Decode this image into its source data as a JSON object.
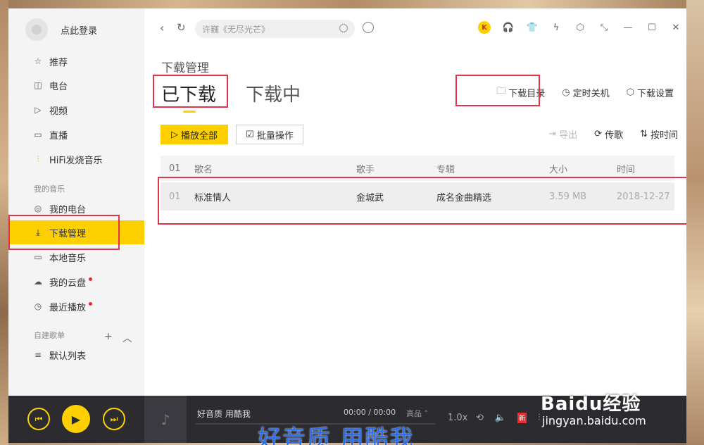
{
  "sidebar": {
    "login_text": "点此登录",
    "items": [
      {
        "label": "推荐",
        "icon": "star-icon"
      },
      {
        "label": "电台",
        "icon": "radio-icon"
      },
      {
        "label": "视频",
        "icon": "video-icon"
      },
      {
        "label": "直播",
        "icon": "live-icon"
      },
      {
        "label": "HiFi发烧音乐",
        "icon": "hifi-icon"
      }
    ],
    "my_music_label": "我的音乐",
    "my_items": [
      {
        "label": "我的电台",
        "icon": "my-radio-icon"
      },
      {
        "label": "下载管理",
        "icon": "download-icon",
        "active": true
      },
      {
        "label": "本地音乐",
        "icon": "local-music-icon"
      },
      {
        "label": "我的云盘",
        "icon": "cloud-icon",
        "dot": true
      },
      {
        "label": "最近播放",
        "icon": "clock-icon",
        "dot": true
      }
    ],
    "custom_label": "自建歌单",
    "custom_items": [
      {
        "label": "默认列表",
        "icon": "list-icon"
      }
    ]
  },
  "search": {
    "placeholder": "许巍《无尽光芒》"
  },
  "main": {
    "page_title": "下载管理",
    "tab_downloaded": "已下载",
    "tab_downloading": "下载中",
    "actions": {
      "download_dir": "下载目录",
      "timer_shutdown": "定时关机",
      "download_settings": "下载设置"
    },
    "play_all": "播放全部",
    "batch_ops": "批量操作",
    "export": "导出",
    "upload": "传歌",
    "sort_by_time": "按时间",
    "table": {
      "headers": [
        "01",
        "歌名",
        "歌手",
        "专辑",
        "大小",
        "时间"
      ],
      "rows": [
        {
          "index": "01",
          "title": "标准情人",
          "artist": "金城武",
          "album": "成名金曲精选",
          "size": "3.59 MB",
          "date": "2018-12-27"
        }
      ]
    }
  },
  "player": {
    "song_title": "好音质 用酷我",
    "time": "00:00 / 00:00",
    "quality": "高品",
    "speed": "1.0x",
    "new_badge": "新"
  },
  "overlay": {
    "watermark": "Baidu经验",
    "watermark_url": "jingyan.baidu.com",
    "subtitle": "好音质 用酷我"
  },
  "colors": {
    "accent": "#ffd000",
    "highlight_box": "#e0344a",
    "player_bg": "#2c2c30"
  }
}
